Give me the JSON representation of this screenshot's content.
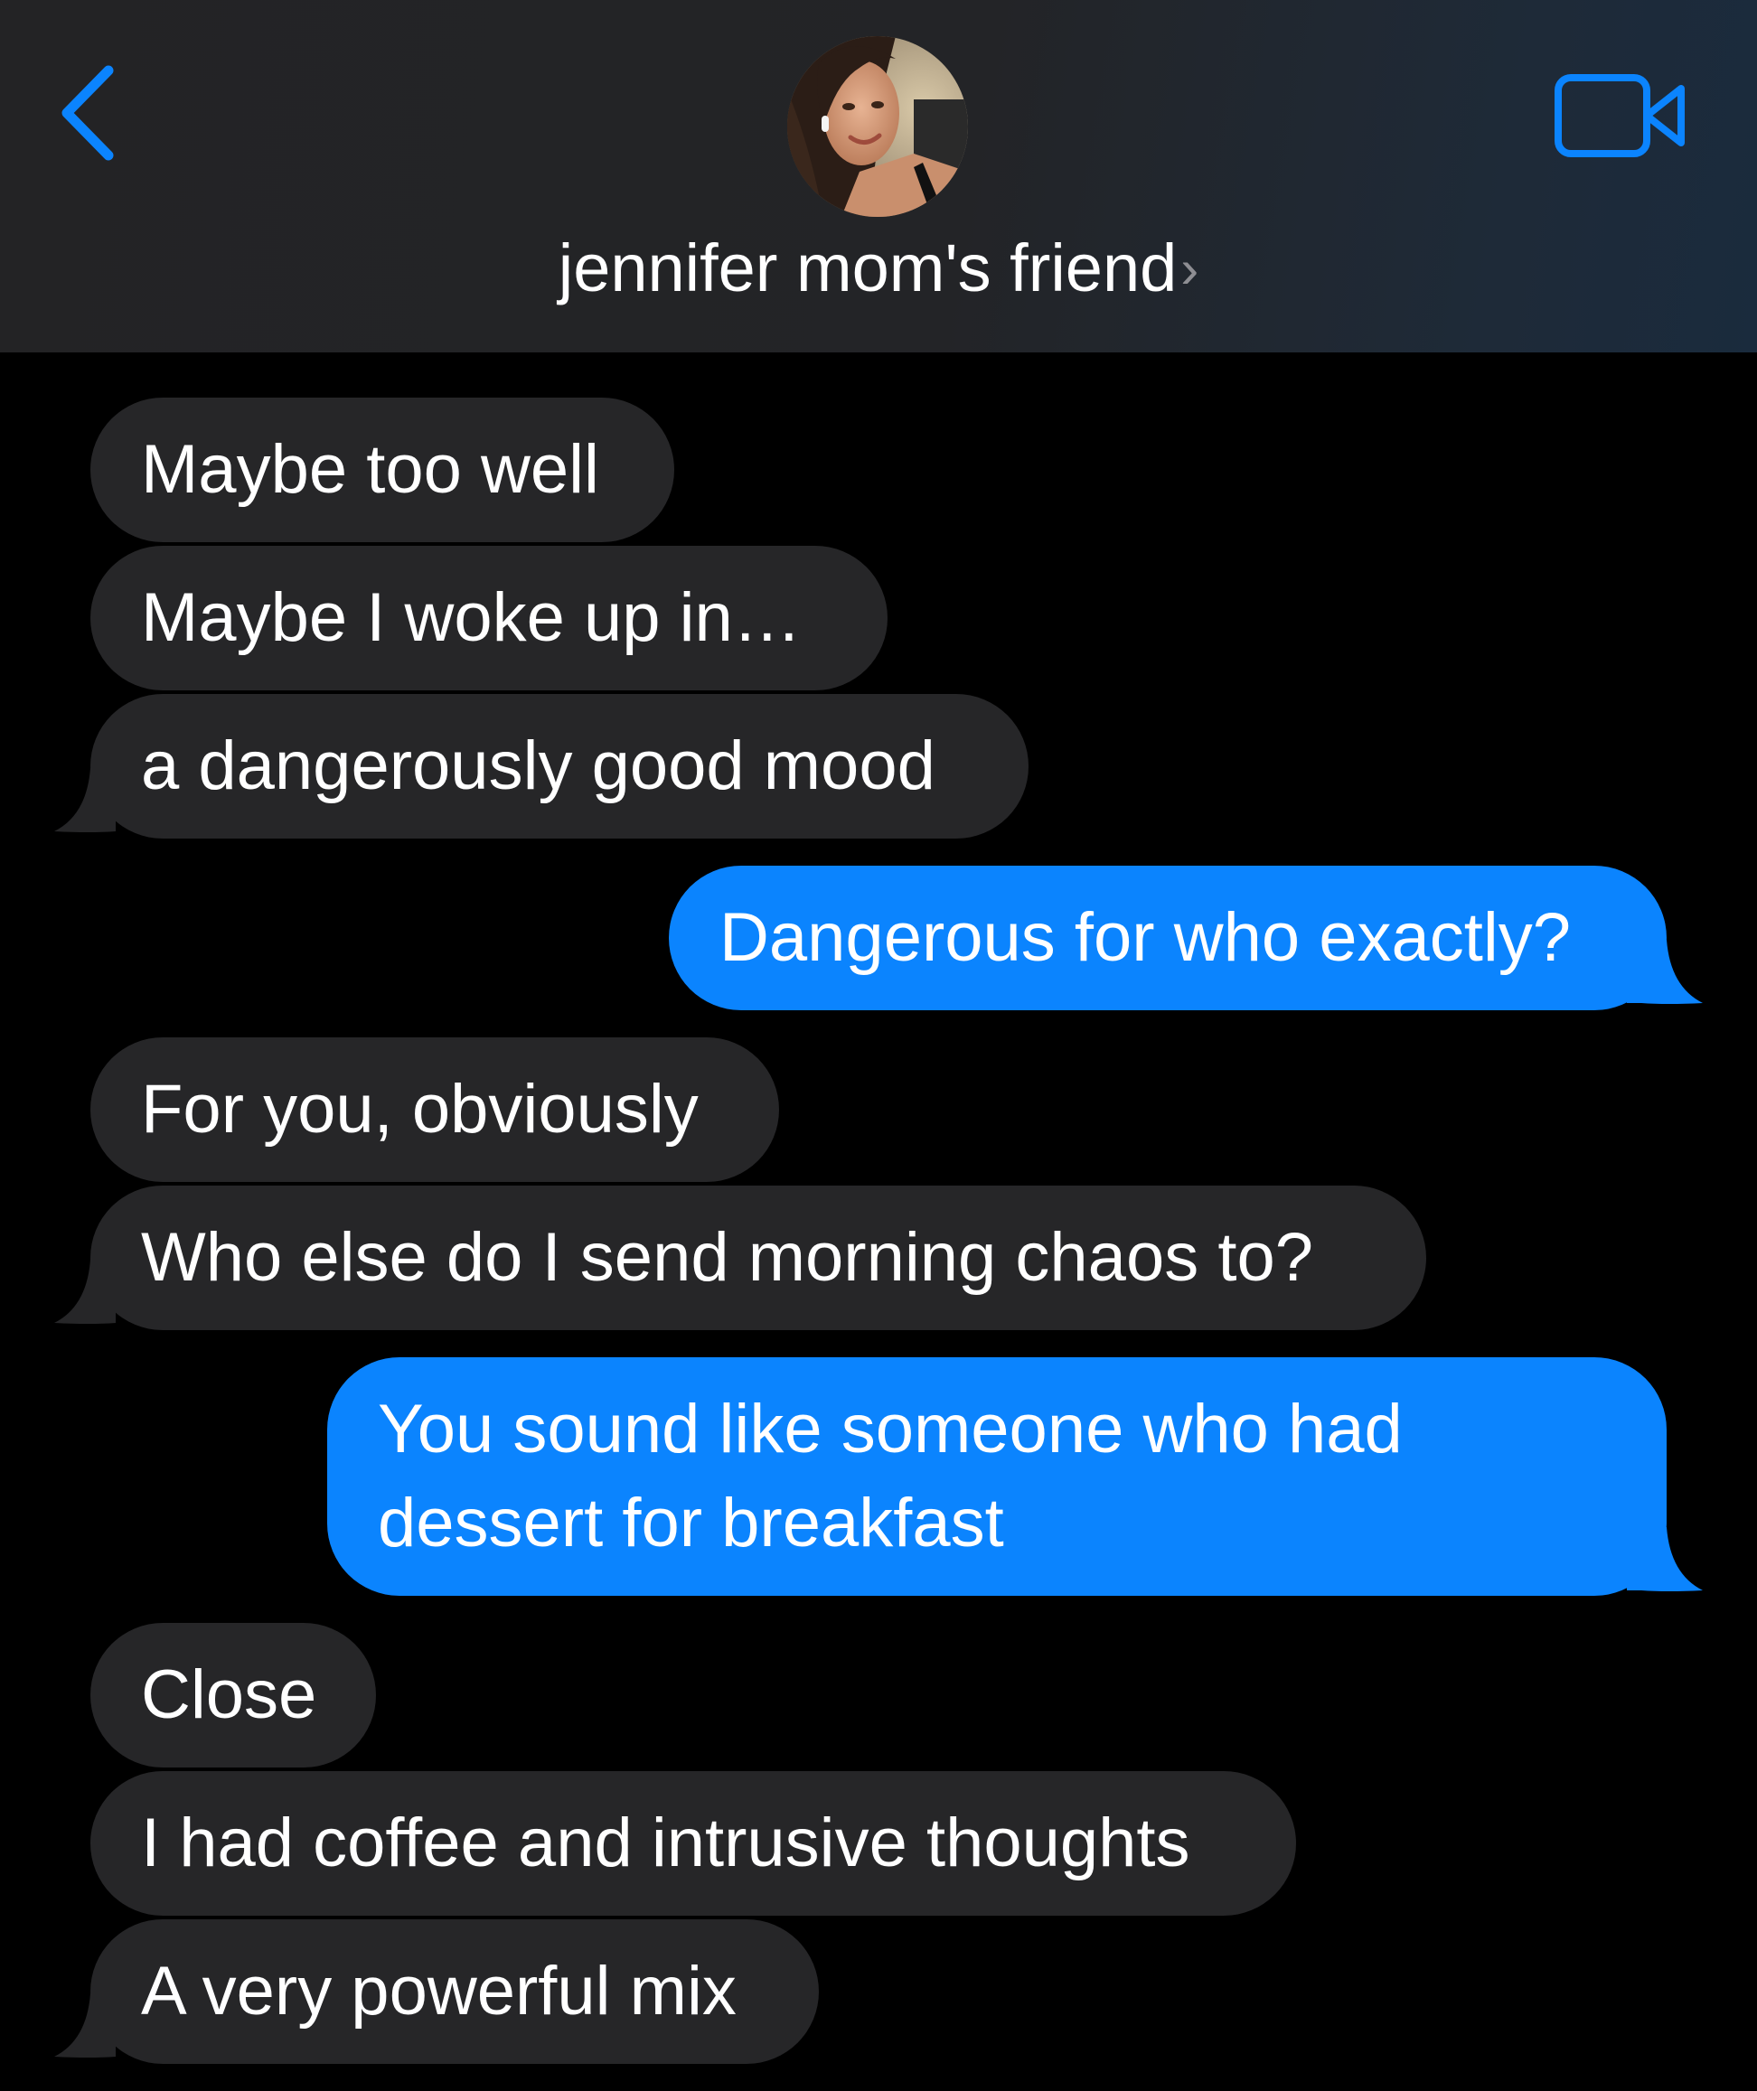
{
  "header": {
    "contact_name": "jennifer mom's friend",
    "name_chevron": "›",
    "back_icon": "chevron-left-icon",
    "video_icon": "video-camera-icon",
    "accent_color": "#0b84fe"
  },
  "colors": {
    "incoming_bubble": "#262628",
    "outgoing_bubble": "#0b84fe",
    "background": "#000000"
  },
  "messages": [
    {
      "direction": "incoming",
      "text": "Maybe too well"
    },
    {
      "direction": "incoming",
      "text": "Maybe I woke up in…"
    },
    {
      "direction": "incoming",
      "text": "a dangerously good mood"
    },
    {
      "direction": "outgoing",
      "text": "Dangerous for who exactly?"
    },
    {
      "direction": "incoming",
      "text": "For you, obviously"
    },
    {
      "direction": "incoming",
      "text": "Who else do I send morning chaos to?"
    },
    {
      "direction": "outgoing",
      "lines": [
        "You sound like someone who had",
        "dessert for breakfast"
      ]
    },
    {
      "direction": "incoming",
      "text": "Close"
    },
    {
      "direction": "incoming",
      "text": "I had coffee and intrusive thoughts"
    },
    {
      "direction": "incoming",
      "text": "A very powerful mix"
    }
  ]
}
